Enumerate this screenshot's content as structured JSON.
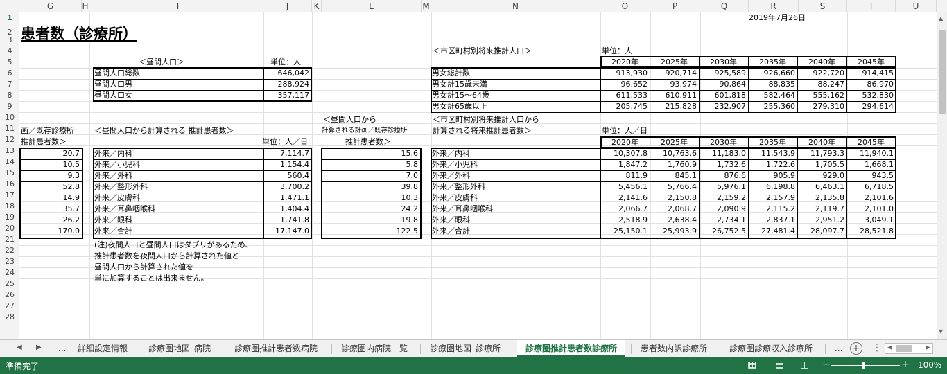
{
  "columns": [
    "G",
    "H",
    "I",
    "J",
    "K",
    "L",
    "M",
    "N",
    "O",
    "P",
    "Q",
    "R",
    "S",
    "T",
    "U"
  ],
  "rows": [
    "1",
    "2",
    "3",
    "4",
    "5",
    "6",
    "7",
    "8",
    "9",
    "10",
    "11",
    "12",
    "13",
    "14",
    "15",
    "16",
    "17",
    "18",
    "19",
    "20",
    "21",
    "22",
    "23",
    "24",
    "25",
    "26",
    "27",
    "28"
  ],
  "date": "2019年7月26日",
  "title": "患者数（診療所）",
  "daytime": {
    "heading": "＜昼間人口＞",
    "unit": "単位：人",
    "rows": [
      {
        "label": "昼間人口総数",
        "value": "646,042"
      },
      {
        "label": "昼間人口男",
        "value": "288,924"
      },
      {
        "label": "昼間人口女",
        "value": "357,117"
      }
    ]
  },
  "future_pop": {
    "heading": "＜市区町村別将来推計人口＞",
    "unit": "単位：人",
    "years": [
      "2020年",
      "2025年",
      "2030年",
      "2035年",
      "2040年",
      "2045年"
    ],
    "rows": [
      {
        "label": "男女総計数",
        "values": [
          "913,930",
          "920,714",
          "925,589",
          "926,660",
          "922,720",
          "914,415"
        ]
      },
      {
        "label": "男女計15歳未満",
        "values": [
          "96,652",
          "93,974",
          "90,864",
          "88,835",
          "88,247",
          "86,970"
        ]
      },
      {
        "label": "男女計15～64歳",
        "values": [
          "611,533",
          "610,911",
          "601,818",
          "582,464",
          "555,162",
          "532,830"
        ]
      },
      {
        "label": "男女計65歳以上",
        "values": [
          "205,745",
          "215,828",
          "232,907",
          "255,360",
          "279,310",
          "294,614"
        ]
      }
    ]
  },
  "left_plan": {
    "heading1": "画／既存診療所",
    "heading2": "推計患者数＞",
    "values": [
      "20.7",
      "10.5",
      "9.3",
      "52.8",
      "14.9",
      "35.7",
      "26.2",
      "170.0"
    ]
  },
  "daytime_patients": {
    "heading": "＜昼間人口から計算される 推計患者数＞",
    "unit": "単位：人／日",
    "rows": [
      {
        "label": "外来／内科",
        "value": "7,114.7"
      },
      {
        "label": "外来／小児科",
        "value": "1,154.4"
      },
      {
        "label": "外来／外科",
        "value": "560.4"
      },
      {
        "label": "外来／整形外科",
        "value": "3,700.2"
      },
      {
        "label": "外来／皮膚科",
        "value": "1,471.1"
      },
      {
        "label": "外来／耳鼻咽喉科",
        "value": "1,404.4"
      },
      {
        "label": "外来／眼科",
        "value": "1,741.8"
      },
      {
        "label": "外来／合計",
        "value": "17,147.0"
      }
    ]
  },
  "plan": {
    "heading1": "＜昼間人口から",
    "heading2": "計算される計画／既存診療所",
    "heading3": "推計患者数＞",
    "values": [
      "15.6",
      "5.8",
      "7.0",
      "39.8",
      "10.3",
      "24.2",
      "19.8",
      "122.5"
    ]
  },
  "future_patients": {
    "heading1": "＜市区町村別将来推計人口から",
    "heading2": "計算される将来推計患者数＞",
    "unit": "単位：人／日",
    "years": [
      "2020年",
      "2025年",
      "2030年",
      "2035年",
      "2040年",
      "2045年"
    ],
    "rows": [
      {
        "label": "外来／内科",
        "values": [
          "10,307.8",
          "10,763.6",
          "11,183.0",
          "11,543.9",
          "11,793.3",
          "11,940.1"
        ]
      },
      {
        "label": "外来／小児科",
        "values": [
          "1,847.2",
          "1,760.9",
          "1,732.6",
          "1,722.6",
          "1,705.5",
          "1,668.1"
        ]
      },
      {
        "label": "外来／外科",
        "values": [
          "811.9",
          "845.1",
          "876.6",
          "905.9",
          "929.0",
          "943.5"
        ]
      },
      {
        "label": "外来／整形外科",
        "values": [
          "5,456.1",
          "5,766.4",
          "5,976.1",
          "6,198.8",
          "6,463.1",
          "6,718.5"
        ]
      },
      {
        "label": "外来／皮膚科",
        "values": [
          "2,141.6",
          "2,150.8",
          "2,159.2",
          "2,157.9",
          "2,135.8",
          "2,101.6"
        ]
      },
      {
        "label": "外来／耳鼻咽喉科",
        "values": [
          "2,066.7",
          "2,068.7",
          "2,090.9",
          "2,115.2",
          "2,119.7",
          "2,101.0"
        ]
      },
      {
        "label": "外来／眼科",
        "values": [
          "2,518.9",
          "2,638.4",
          "2,734.1",
          "2,837.1",
          "2,951.2",
          "3,049.1"
        ]
      },
      {
        "label": "外来／合計",
        "values": [
          "25,150.1",
          "25,993.9",
          "26,752.5",
          "27,481.4",
          "28,097.7",
          "28,521.8"
        ]
      }
    ]
  },
  "notes": [
    "(注)夜間人口と昼間人口はダブリがあるため、",
    "推計患者数を夜間人口から計算された値と",
    "昼間人口から計算された値を",
    "単に加算することは出来ません。"
  ],
  "tabs": [
    "...",
    "詳細設定情報",
    "診療圏地図_病院",
    "診療圏推計患者数病院",
    "診療圏内病院一覧",
    "診療圏地図_診療所",
    "診療圏推計患者数診療所",
    "患者数内訳診療所",
    "診療圏診療収入診療所",
    "..."
  ],
  "status": {
    "ready": "準備完了",
    "zoom": "100%"
  }
}
